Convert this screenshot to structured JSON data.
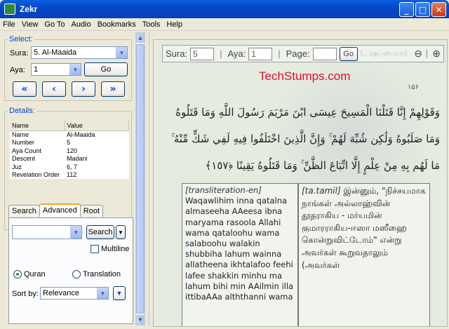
{
  "window": {
    "title": "Zekr",
    "min_label": "_",
    "max_label": "□",
    "close_label": "✕"
  },
  "menu": {
    "items": [
      "File",
      "View",
      "Go To",
      "Audio",
      "Bookmarks",
      "Tools",
      "Help"
    ]
  },
  "select": {
    "group_title": "Select:",
    "sura_label": "Sura:",
    "sura_value": "5. Al-Maaida",
    "aya_label": "Aya:",
    "aya_value": "1",
    "go_label": "Go",
    "nav": {
      "first": "«",
      "prev": "‹",
      "next": "›",
      "last": "»"
    }
  },
  "details": {
    "group_title": "Details:",
    "headers": [
      "Name",
      "Value"
    ],
    "rows": [
      [
        "Name",
        "Al-Maaida"
      ],
      [
        "Number",
        "5"
      ],
      [
        "Aya Count",
        "120"
      ],
      [
        "Descent",
        "Madani"
      ],
      [
        "Juz",
        "6, 7"
      ],
      [
        "Revelation Order",
        "112"
      ]
    ]
  },
  "tabs": [
    "Search",
    "Advanced",
    "Root"
  ],
  "search": {
    "button_label": "Search",
    "multiline_label": "Multiline",
    "quran_label": "Quran",
    "translation_label": "Translation",
    "sort_label": "Sort by:",
    "sort_value": "Relevance"
  },
  "quran_bar": {
    "sura_label": "Sura:",
    "sura_value": "5",
    "aya_label": "Aya:",
    "aya_value": "1",
    "page_label": "Page:",
    "go_label": "Go",
    "behind_text": "(…ரதப்பையா)"
  },
  "overlay_text": "TechStumps.com",
  "page_ornament": "۱۵۶",
  "arabic_lines": [
    "وَقَوْلِهِمْ إِنَّا قَتَلْنَا الْمَسِيحَ عِيسَى ابْنَ مَرْيَمَ رَسُولَ اللَّهِ وَمَا قَتَلُوهُ",
    "وَمَا صَلَبُوهُ وَلَٰكِن شُبِّهَ لَهُمْ ۚ وَإِنَّ الَّذِينَ اخْتَلَفُوا فِيهِ لَفِي شَكٍّ مِّنْهُ ۚ",
    "مَا لَهُم بِهِ مِنْ عِلْمٍ إِلَّا اتِّبَاعَ الظَّنِّ ۚ وَمَا قَتَلُوهُ يَقِينًا ﴿١٥٧﴾"
  ],
  "transliteration": {
    "heading": "[transliteration-en]",
    "text": "Waqawlihim inna qatalna almaseeha AAeesa ibna maryama rasoola Allahi wama qataloohu wama salaboohu walakin shubbiha lahum wainna allatheena ikhtalafoo feehi lafee shakkin minhu ma lahum bihi min AAilmin illa ittibaAAa alththanni wama"
  },
  "tamil": {
    "heading": "[ta.tamil]",
    "text": "இன்னும், \"நிச்சயமாக நாங்கள் அல்லாஹ்வின் தூதராகிய - மர்யமின் குமாரராகிய-ஈஸா மஸீஹை கொன்றுவிட்டோம்\" என்று அவர்கள் கூறுவதாலும் (அவர்கள்"
  }
}
